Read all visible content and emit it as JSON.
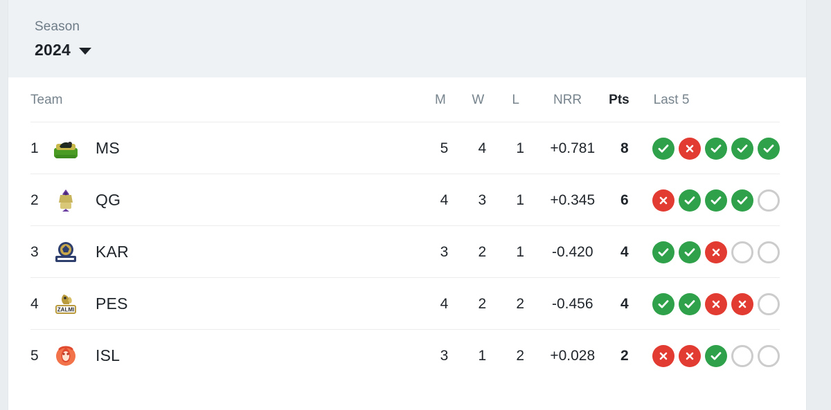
{
  "season": {
    "label": "Season",
    "value": "2024",
    "caret_icon": "chevron-down-icon"
  },
  "table": {
    "headers": {
      "team": "Team",
      "matches": "M",
      "wins": "W",
      "losses": "L",
      "nrr": "NRR",
      "points": "Pts",
      "last5": "Last 5"
    },
    "rows": [
      {
        "rank": "1",
        "team": "MS",
        "logo": "multan-sultans-logo",
        "matches": "5",
        "wins": "4",
        "losses": "1",
        "nrr": "+0.781",
        "points": "8",
        "last5": [
          "win",
          "loss",
          "win",
          "win",
          "win"
        ]
      },
      {
        "rank": "2",
        "team": "QG",
        "logo": "quetta-gladiators-logo",
        "matches": "4",
        "wins": "3",
        "losses": "1",
        "nrr": "+0.345",
        "points": "6",
        "last5": [
          "loss",
          "win",
          "win",
          "win",
          "none"
        ]
      },
      {
        "rank": "3",
        "team": "KAR",
        "logo": "karachi-kings-logo",
        "matches": "3",
        "wins": "2",
        "losses": "1",
        "nrr": "-0.420",
        "points": "4",
        "last5": [
          "win",
          "win",
          "loss",
          "none",
          "none"
        ]
      },
      {
        "rank": "4",
        "team": "PES",
        "logo": "peshawar-zalmi-logo",
        "matches": "4",
        "wins": "2",
        "losses": "2",
        "nrr": "-0.456",
        "points": "4",
        "last5": [
          "win",
          "win",
          "loss",
          "loss",
          "none"
        ]
      },
      {
        "rank": "5",
        "team": "ISL",
        "logo": "islamabad-united-logo",
        "matches": "3",
        "wins": "1",
        "losses": "2",
        "nrr": "+0.028",
        "points": "2",
        "last5": [
          "loss",
          "loss",
          "win",
          "none",
          "none"
        ]
      }
    ]
  },
  "colors": {
    "win": "#2fa14a",
    "loss": "#e23b32",
    "empty": "#cccccc",
    "header_band": "#eef2f5",
    "page_bg": "#e9edf0"
  }
}
